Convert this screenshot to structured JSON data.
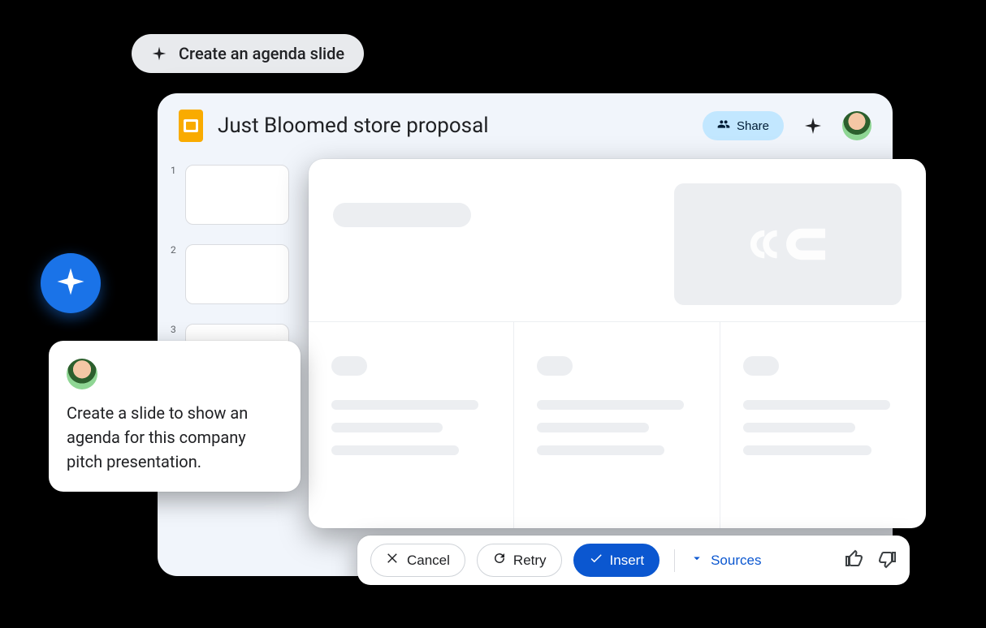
{
  "suggestion_chip": {
    "label": "Create an agenda slide"
  },
  "header": {
    "doc_title": "Just Bloomed store proposal",
    "share_label": "Share"
  },
  "filmstrip": {
    "thumbnails": [
      {
        "index": "1"
      },
      {
        "index": "2"
      },
      {
        "index": "3"
      }
    ]
  },
  "actions": {
    "cancel": "Cancel",
    "retry": "Retry",
    "insert": "Insert",
    "sources": "Sources"
  },
  "prompt_card": {
    "text": "Create a slide to show an agenda for this company pitch presentation."
  },
  "colors": {
    "accent": "#0b57d0",
    "brand_blue": "#1a73e8",
    "slides_yellow": "#f9ab00",
    "share_chip": "#c2e7ff"
  }
}
